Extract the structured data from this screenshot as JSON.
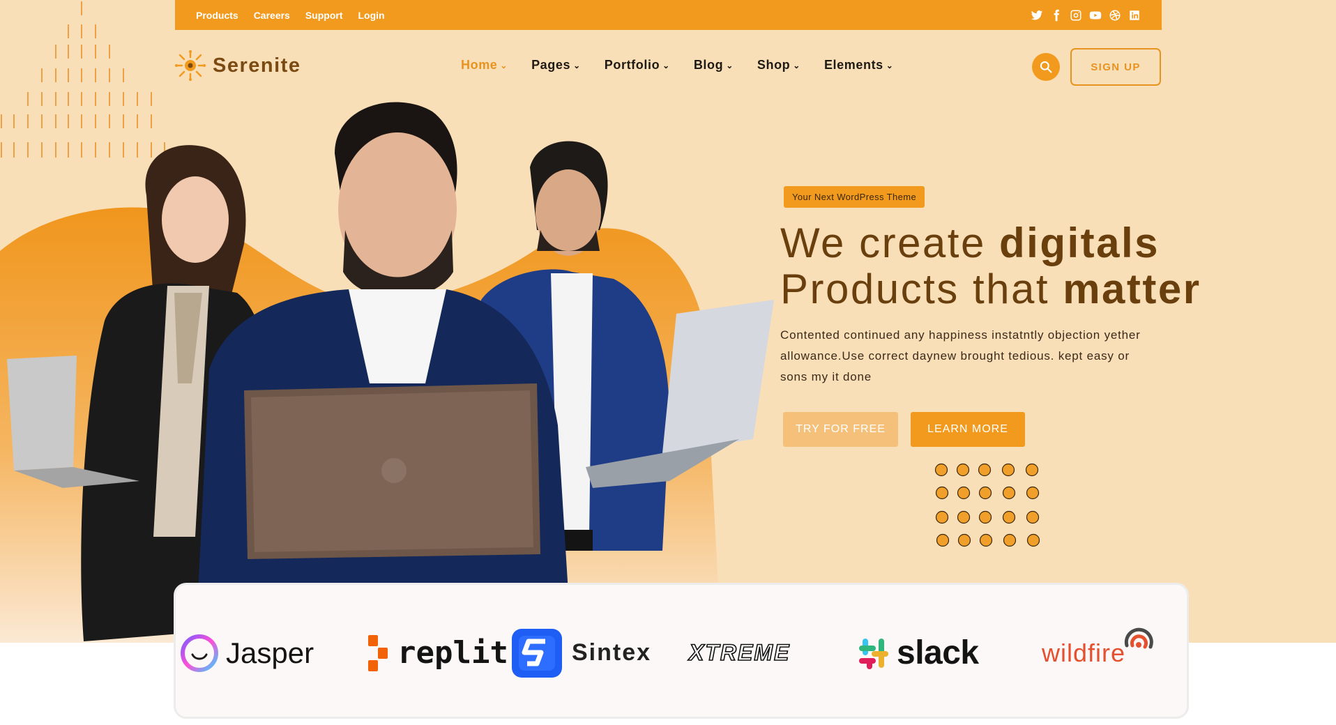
{
  "topbar": {
    "links": [
      "Products",
      "Careers",
      "Support",
      "Login"
    ],
    "social_icons": [
      "twitter-icon",
      "facebook-icon",
      "instagram-icon",
      "youtube-icon",
      "dribbble-icon",
      "linkedin-icon"
    ]
  },
  "header": {
    "logo_text": "Serenite",
    "nav": [
      {
        "label": "Home",
        "active": true
      },
      {
        "label": "Pages",
        "active": false
      },
      {
        "label": "Portfolio",
        "active": false
      },
      {
        "label": "Blog",
        "active": false
      },
      {
        "label": "Shop",
        "active": false
      },
      {
        "label": "Elements",
        "active": false
      }
    ],
    "signup_label": "SIGN UP"
  },
  "hero": {
    "tagline": "Your Next WordPress Theme",
    "headline_line1_plain": "We create ",
    "headline_line1_bold": "digitals",
    "headline_line2_plain": "Products that ",
    "headline_line2_bold": "matter",
    "description": "Contented continued any happiness instatntly objection yether allowance.Use correct daynew brought tedious. kept easy or sons my it done",
    "try_button": "TRY FOR FREE",
    "learn_button": "LEARN MORE"
  },
  "brands": [
    "Jasper",
    "replit",
    "Sintex",
    "XTREME",
    "slack",
    "wildfire"
  ],
  "colors": {
    "accent": "#f19a1e",
    "hero_bg": "#f9dfb8",
    "heading": "#6a3f0e"
  }
}
